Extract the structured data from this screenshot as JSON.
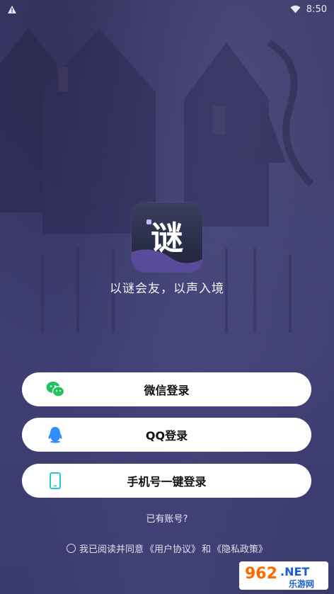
{
  "status_bar": {
    "time": "8:50"
  },
  "app": {
    "logo_text": "谜",
    "slogan": "以谜会友，以声入境"
  },
  "login": {
    "wechat_label": "微信登录",
    "qq_label": "QQ登录",
    "phone_label": "手机号一键登录",
    "has_account": "已有账号?"
  },
  "agreement": {
    "prefix": "我已阅读并同意",
    "user_agreement": "《用户协议》",
    "and": "和",
    "privacy_policy": "《隐私政策》"
  },
  "watermark": {
    "number": "962",
    "suffix": ".NET",
    "subtitle": "乐游网"
  },
  "colors": {
    "background": "#3c3b6c",
    "button_bg": "#ffffff",
    "wechat_icon": "#22c35e",
    "qq_icon": "#2f8fff",
    "phone_icon": "#29c6d8"
  }
}
